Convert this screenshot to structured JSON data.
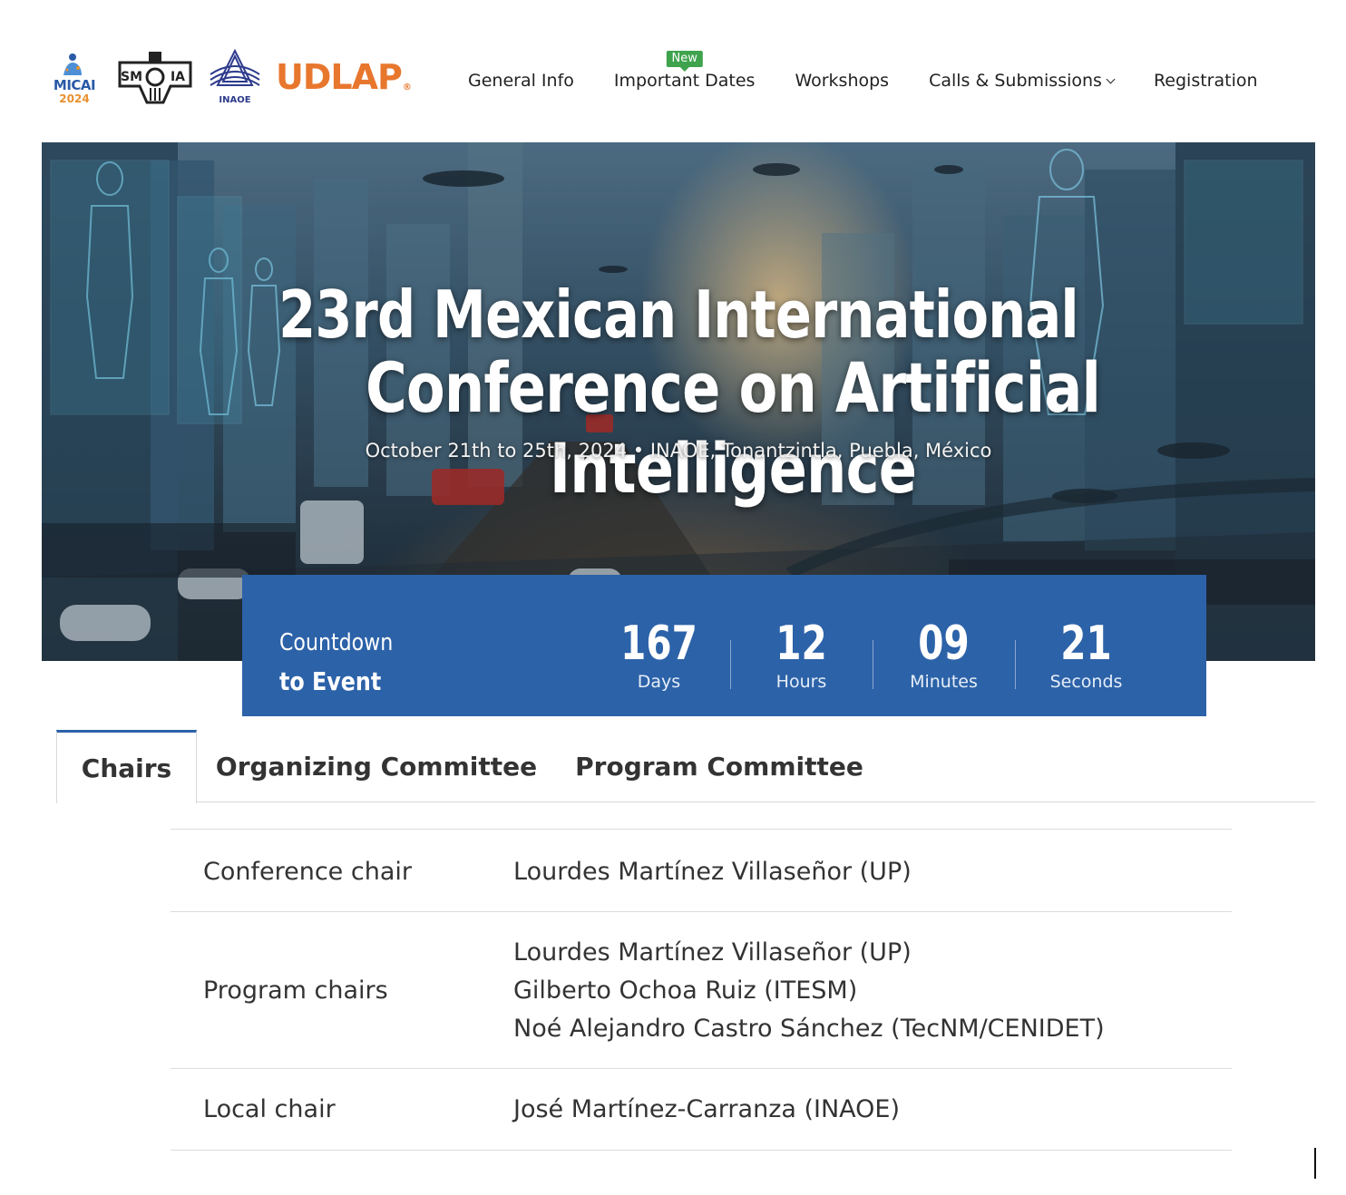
{
  "header": {
    "logos": {
      "micai": {
        "text": "MICAI",
        "year": "2024"
      },
      "smia": "SMIA",
      "inaoe": "INAOE",
      "udlap": "UDLAP",
      "udlap_reg": "®"
    },
    "nav": [
      {
        "label": "General Info"
      },
      {
        "label": "Important Dates",
        "badge": "New"
      },
      {
        "label": "Workshops"
      },
      {
        "label": "Calls & Submissions"
      },
      {
        "label": "Registration"
      }
    ]
  },
  "hero": {
    "title_line1": "23rd Mexican International",
    "title_line2": "Conference on Artificial Intelligence",
    "subtitle": "October 21th to 25th, 2024 • INAOE, Tonantzintla, Puebla, México"
  },
  "countdown": {
    "label_line1": "Countdown",
    "label_line2": "to Event",
    "units": [
      {
        "value": "167",
        "label": "Days"
      },
      {
        "value": "12",
        "label": "Hours"
      },
      {
        "value": "09",
        "label": "Minutes"
      },
      {
        "value": "21",
        "label": "Seconds"
      }
    ]
  },
  "tabs": [
    {
      "label": "Chairs",
      "active": true
    },
    {
      "label": "Organizing Committee",
      "active": false
    },
    {
      "label": "Program Committee",
      "active": false
    }
  ],
  "chairs": [
    {
      "role": "Conference chair",
      "names": [
        "Lourdes Martínez Villaseñor (UP)"
      ]
    },
    {
      "role": "Program chairs",
      "names": [
        "Lourdes Martínez Villaseñor (UP)",
        "Gilberto Ochoa Ruiz (ITESM)",
        "Noé Alejandro Castro Sánchez (TecNM/CENIDET)"
      ]
    },
    {
      "role": "Local chair",
      "names": [
        "José Martínez-Carranza (INAOE)"
      ]
    }
  ],
  "colors": {
    "accent_blue": "#2c62a8",
    "badge_green": "#3fa34d",
    "udlap_orange": "#e8772e",
    "micai_blue": "#2a5aa7"
  }
}
